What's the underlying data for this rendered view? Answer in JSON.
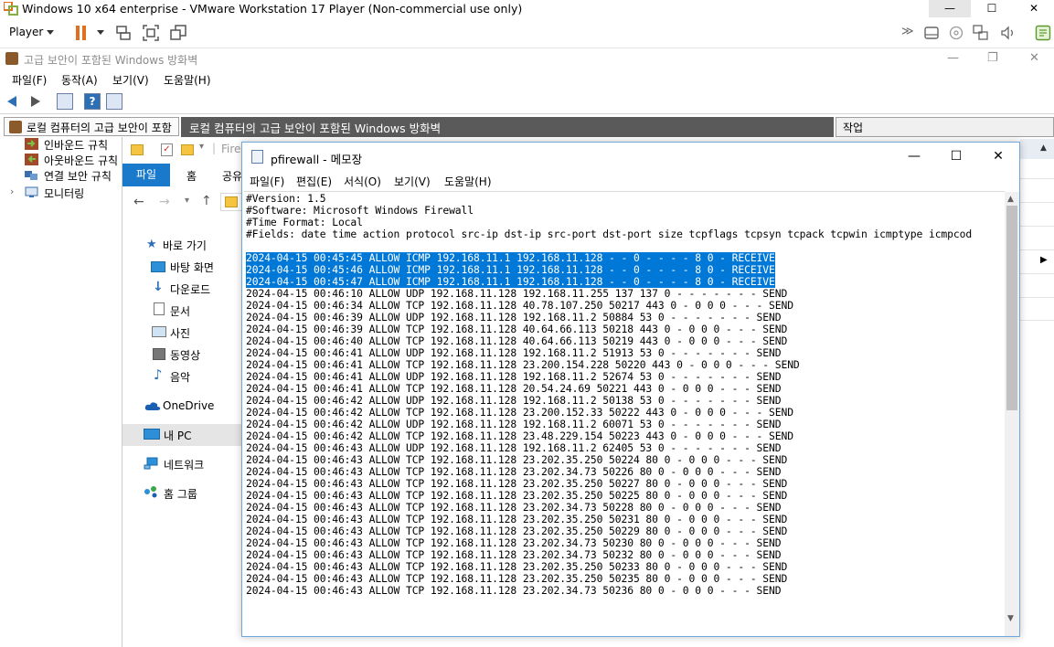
{
  "vm": {
    "title": "Windows 10 x64 enterprise - VMware Workstation 17 Player (Non-commercial use only)",
    "player_label": "Player",
    "controls": {
      "minimize": "—",
      "maximize": "☐",
      "close": "✕"
    }
  },
  "mmc": {
    "title": "고급 보안이 포함된 Windows 방화벽",
    "menu": [
      "파일(F)",
      "동작(A)",
      "보기(V)",
      "도움말(H)"
    ],
    "tree_header": "로컬 컴퓨터의 고급 보안이 포함",
    "center_header": "로컬 컴퓨터의 고급 보안이 포함된 Windows 방화벽",
    "actions_header": "작업",
    "tree_items": [
      "인바운드 규칙",
      "아웃바운드 규칙",
      "연결 보안 규칙",
      "모니터링"
    ]
  },
  "explorer": {
    "path_fragment": "Fire",
    "tabs": {
      "file": "파일",
      "home": "홈",
      "share": "공유"
    },
    "nav": {
      "quick_access": "바로 가기",
      "desktop": "바탕 화면",
      "downloads": "다운로드",
      "documents": "문서",
      "pictures": "사진",
      "videos": "동영상",
      "music": "음악",
      "onedrive": "OneDrive",
      "this_pc": "내 PC",
      "network": "네트워크",
      "homegroup": "홈 그룹"
    }
  },
  "notepad": {
    "title": "pfirewall - 메모장",
    "menu": [
      "파일(F)",
      "편집(E)",
      "서식(O)",
      "보기(V)",
      "도움말(H)"
    ],
    "selected_line_count": 3,
    "lines": [
      "#Version: 1.5",
      "#Software: Microsoft Windows Firewall",
      "#Time Format: Local",
      "#Fields: date time action protocol src-ip dst-ip src-port dst-port size tcpflags tcpsyn tcpack tcpwin icmptype icmpcod",
      "",
      "2024-04-15 00:45:45 ALLOW ICMP 192.168.11.1 192.168.11.128 - - 0 - - - - 8 0 - RECEIVE",
      "2024-04-15 00:45:46 ALLOW ICMP 192.168.11.1 192.168.11.128 - - 0 - - - - 8 0 - RECEIVE",
      "2024-04-15 00:45:47 ALLOW ICMP 192.168.11.1 192.168.11.128 - - 0 - - - - 8 0 - RECEIVE",
      "2024-04-15 00:46:10 ALLOW UDP 192.168.11.128 192.168.11.255 137 137 0 - - - - - - - SEND",
      "2024-04-15 00:46:34 ALLOW TCP 192.168.11.128 40.78.107.250 50217 443 0 - 0 0 0 - - - SEND",
      "2024-04-15 00:46:39 ALLOW UDP 192.168.11.128 192.168.11.2 50884 53 0 - - - - - - - SEND",
      "2024-04-15 00:46:39 ALLOW TCP 192.168.11.128 40.64.66.113 50218 443 0 - 0 0 0 - - - SEND",
      "2024-04-15 00:46:40 ALLOW TCP 192.168.11.128 40.64.66.113 50219 443 0 - 0 0 0 - - - SEND",
      "2024-04-15 00:46:41 ALLOW UDP 192.168.11.128 192.168.11.2 51913 53 0 - - - - - - - SEND",
      "2024-04-15 00:46:41 ALLOW TCP 192.168.11.128 23.200.154.228 50220 443 0 - 0 0 0 - - - SEND",
      "2024-04-15 00:46:41 ALLOW UDP 192.168.11.128 192.168.11.2 52674 53 0 - - - - - - - SEND",
      "2024-04-15 00:46:41 ALLOW TCP 192.168.11.128 20.54.24.69 50221 443 0 - 0 0 0 - - - SEND",
      "2024-04-15 00:46:42 ALLOW UDP 192.168.11.128 192.168.11.2 50138 53 0 - - - - - - - SEND",
      "2024-04-15 00:46:42 ALLOW TCP 192.168.11.128 23.200.152.33 50222 443 0 - 0 0 0 - - - SEND",
      "2024-04-15 00:46:42 ALLOW UDP 192.168.11.128 192.168.11.2 60071 53 0 - - - - - - - SEND",
      "2024-04-15 00:46:42 ALLOW TCP 192.168.11.128 23.48.229.154 50223 443 0 - 0 0 0 - - - SEND",
      "2024-04-15 00:46:43 ALLOW UDP 192.168.11.128 192.168.11.2 62405 53 0 - - - - - - - SEND",
      "2024-04-15 00:46:43 ALLOW TCP 192.168.11.128 23.202.35.250 50224 80 0 - 0 0 0 - - - SEND",
      "2024-04-15 00:46:43 ALLOW TCP 192.168.11.128 23.202.34.73 50226 80 0 - 0 0 0 - - - SEND",
      "2024-04-15 00:46:43 ALLOW TCP 192.168.11.128 23.202.35.250 50227 80 0 - 0 0 0 - - - SEND",
      "2024-04-15 00:46:43 ALLOW TCP 192.168.11.128 23.202.35.250 50225 80 0 - 0 0 0 - - - SEND",
      "2024-04-15 00:46:43 ALLOW TCP 192.168.11.128 23.202.34.73 50228 80 0 - 0 0 0 - - - SEND",
      "2024-04-15 00:46:43 ALLOW TCP 192.168.11.128 23.202.35.250 50231 80 0 - 0 0 0 - - - SEND",
      "2024-04-15 00:46:43 ALLOW TCP 192.168.11.128 23.202.35.250 50229 80 0 - 0 0 0 - - - SEND",
      "2024-04-15 00:46:43 ALLOW TCP 192.168.11.128 23.202.34.73 50230 80 0 - 0 0 0 - - - SEND",
      "2024-04-15 00:46:43 ALLOW TCP 192.168.11.128 23.202.34.73 50232 80 0 - 0 0 0 - - - SEND",
      "2024-04-15 00:46:43 ALLOW TCP 192.168.11.128 23.202.35.250 50233 80 0 - 0 0 0 - - - SEND",
      "2024-04-15 00:46:43 ALLOW TCP 192.168.11.128 23.202.35.250 50235 80 0 - 0 0 0 - - - SEND",
      "2024-04-15 00:46:43 ALLOW TCP 192.168.11.128 23.202.34.73 50236 80 0 - 0 0 0 - - - SEND"
    ]
  },
  "colors": {
    "selection": "#0078d7",
    "explorer_file_tab": "#1979ca",
    "center_header_bg": "#5a5a5a",
    "vmware_pause": "#e07020"
  }
}
